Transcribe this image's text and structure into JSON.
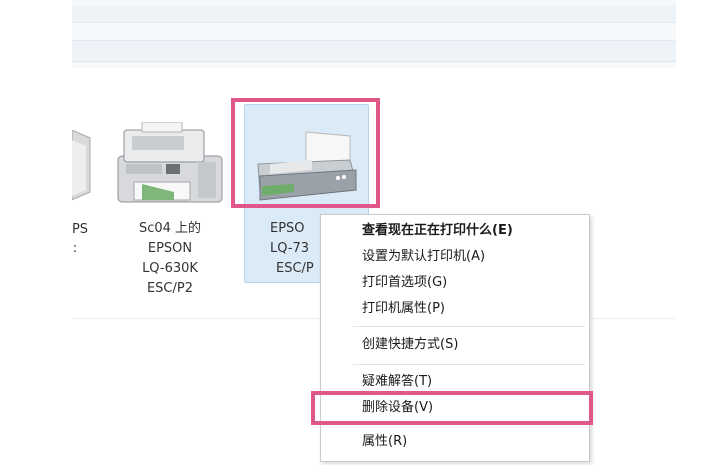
{
  "devices": [
    {
      "label_lines": [
        "PS",
        ":"
      ]
    },
    {
      "label_lines": [
        "Sc04 上的",
        "EPSON",
        "LQ-630K",
        "ESC/P2"
      ]
    },
    {
      "label_lines": [
        "EPSO",
        "LQ-73",
        "ESC/P"
      ]
    }
  ],
  "context_menu": {
    "items": [
      {
        "label": "查看现在正在打印什么(E)",
        "bold": true
      },
      {
        "label": "设置为默认打印机(A)"
      },
      {
        "label": "打印首选项(G)"
      },
      {
        "label": "打印机属性(P)"
      },
      {
        "label": "创建快捷方式(S)"
      },
      {
        "label": "疑难解答(T)"
      },
      {
        "label": "删除设备(V)"
      },
      {
        "label": "属性(R)"
      }
    ]
  },
  "colors": {
    "highlight": "#e0588a",
    "selection": "#dbeaf7"
  }
}
